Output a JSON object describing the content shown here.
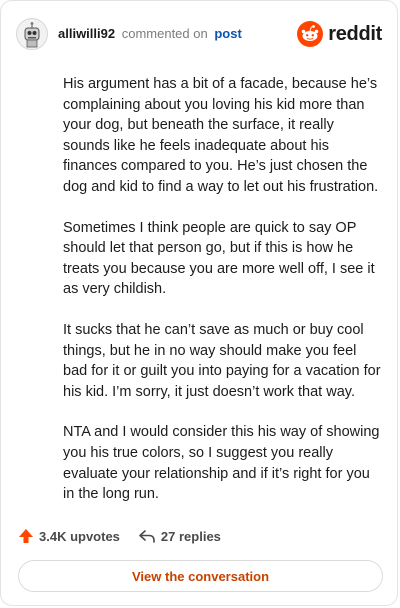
{
  "comment": {
    "username": "alliwilli92",
    "action_text": "commented on",
    "target_text": "post"
  },
  "brand": {
    "name": "reddit",
    "color": "#ff4500"
  },
  "paragraphs": [
    "His argument has a bit of a facade, because he’s complaining about you loving his kid more than your dog, but beneath the surface, it really sounds like he feels inadequate about his finances compared to you. He’s just chosen the dog and kid to find a way to let out his frustration.",
    "Sometimes I think people are quick to say OP should let that person go, but if this is how he treats you because you are more well off, I see it as very childish.",
    "It sucks that he can’t save as much or buy cool things, but he in no way should make you feel bad for it or guilt you into paying for a vacation for his kid. I’m sorry, it just doesn’t work that way.",
    "NTA and I would consider this his way of showing you his true colors, so I suggest you really evaluate your relationship and if it’s right for you in the long run."
  ],
  "stats": {
    "upvotes": "3.4K upvotes",
    "replies": "27 replies"
  },
  "cta": {
    "label": "View the conversation"
  },
  "icons": {
    "upvote": "upvote-arrow-icon",
    "reply": "reply-arrow-icon",
    "logo": "reddit-snoo-icon",
    "avatar": "user-avatar"
  },
  "colors": {
    "upvote": "#ff4500",
    "link": "#0b56b0",
    "cta_text": "#c74200"
  }
}
